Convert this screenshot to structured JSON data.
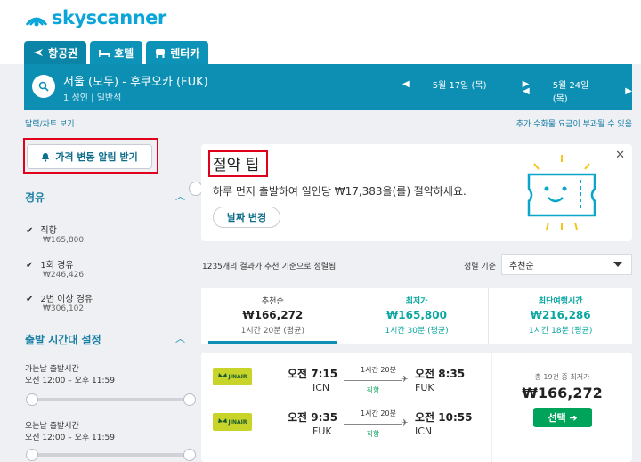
{
  "brand": {
    "name": "skyscanner",
    "color": "#0aa6d9"
  },
  "tabs": [
    {
      "label": "항공권",
      "icon": "plane-icon"
    },
    {
      "label": "호텔",
      "icon": "bed-icon"
    },
    {
      "label": "렌터카",
      "icon": "car-icon"
    }
  ],
  "search": {
    "route": "서울 (모두) - 후쿠오카 (FUK)",
    "passengers": "1 성인",
    "cabin": "일반석",
    "depart_date": "5월 17일 (목)",
    "return_date": "5월 24일 (목)"
  },
  "links": {
    "calendar_chart": "달력/차트 보기",
    "fee_notice": "추가 수화물 요금이 부과될 수 있음"
  },
  "sidebar": {
    "alert_button": "가격 변동 알림 받기",
    "stops_title": "경유",
    "stops": [
      {
        "label": "직항",
        "price": "₩165,800"
      },
      {
        "label": "1회 경유",
        "price": "₩246,426"
      },
      {
        "label": "2번 이상 경유",
        "price": "₩306,102"
      }
    ],
    "time_title": "출발 시간대 설정",
    "outbound_label": "가는날 출발시간",
    "outbound_range": "오전 12:00 – 오후 11:59",
    "return_label": "오는날 출발시간",
    "return_range": "오전 12:00 – 오후 11:59"
  },
  "tip": {
    "title": "절약 팁",
    "text": "하루 먼저 출발하여 일인당 ₩17,383을(를) 절약하세요.",
    "button": "날짜 변경",
    "close": "✕"
  },
  "results": {
    "count_text": "1235개의 결과가 추천 기준으로 정렬됨",
    "sort_label": "정렬 기준",
    "sort_value": "추천순"
  },
  "sort_tabs": [
    {
      "title": "추천순",
      "price": "₩166,272",
      "duration": "1시간 20분 (평균)",
      "color": "#222222"
    },
    {
      "title": "최저가",
      "price": "₩165,800",
      "duration": "1시간 30분 (평균)",
      "color": "#0aa6a0"
    },
    {
      "title": "최단여행시간",
      "price": "₩216,286",
      "duration": "1시간 18분 (평균)",
      "color": "#0aa6a0"
    }
  ],
  "flight": {
    "airline": "JINAIR",
    "outbound": {
      "depart_time": "오전 7:15",
      "depart_code": "ICN",
      "duration": "1시간 20분",
      "stops": "직항",
      "arrive_time": "오전 8:35",
      "arrive_code": "FUK"
    },
    "inbound": {
      "depart_time": "오전 9:35",
      "depart_code": "FUK",
      "duration": "1시간 20분",
      "stops": "직항",
      "arrive_time": "오전 10:55",
      "arrive_code": "ICN"
    },
    "deal_note": "총 19건 중 최저가",
    "price": "₩166,272",
    "select_button": "선택 ➔"
  }
}
